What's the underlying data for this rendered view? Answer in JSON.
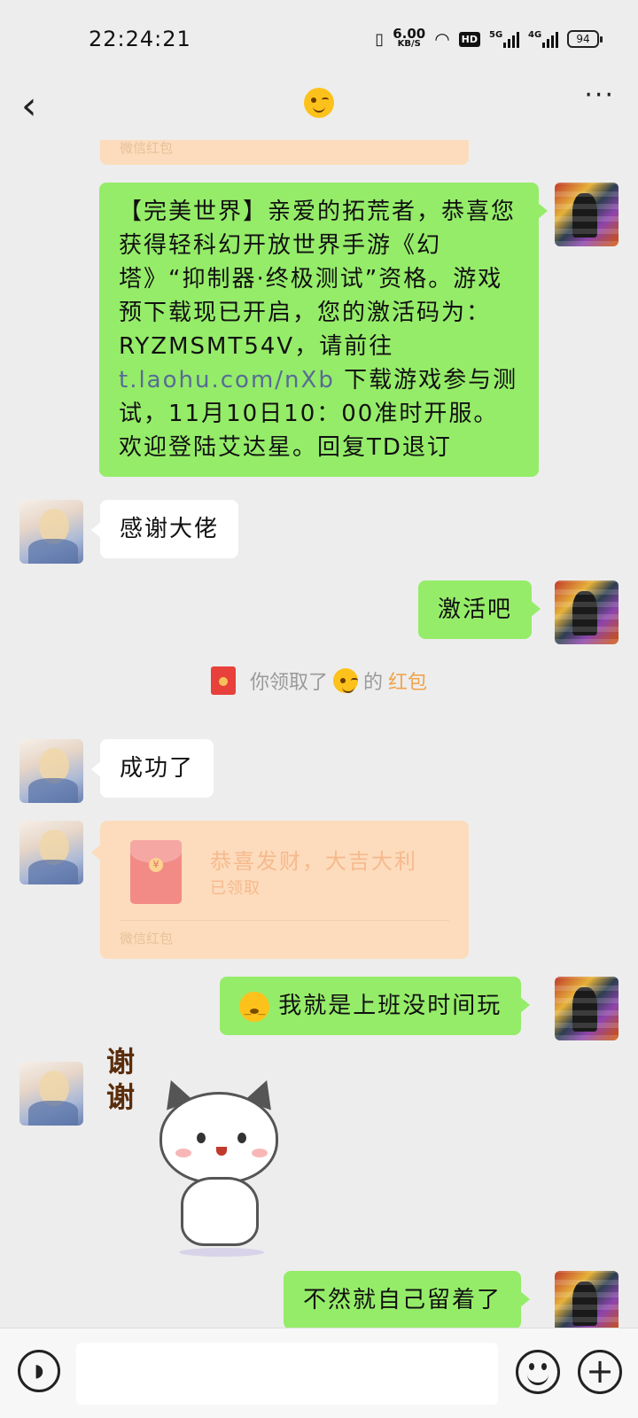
{
  "status_bar": {
    "time": "22:24:21",
    "net_speed_value": "6.00",
    "net_speed_unit": "KB/S",
    "hd_label": "HD",
    "sig1_label": "5G",
    "sig2_label": "4G",
    "battery": "94"
  },
  "header": {
    "title_emoji": "wink-emoji",
    "more": "···",
    "back": "‹"
  },
  "messages": {
    "rp_partial_footer": "微信红包",
    "m1_prefix": "【完美世界】亲爱的拓荒者，恭喜您获得轻科幻开放世界手游《幻塔》“抑制器·终极测试”资格。游戏预下载现已开启，您的激活码为：RYZMSMT54V，请前往 ",
    "m1_link": "t.laohu.com/nXb",
    "m1_suffix": " 下载游戏参与测试，11月10日10：00准时开服。欢迎登陆艾达星。回复TD退订",
    "m2": "感谢大佬",
    "m3": "激活吧",
    "notice_prefix": "你领取了",
    "notice_mid": "的",
    "notice_link": "红包",
    "m4": "成功了",
    "rp_title": "恭喜发财，大吉大利",
    "rp_status": "已领取",
    "rp_footer": "微信红包",
    "m5": "我就是上班没时间玩",
    "sticker_text": "谢谢",
    "m6": "不然就自己留着了"
  },
  "input_bar": {
    "placeholder": "",
    "plus": "+"
  },
  "colors": {
    "self_bubble": "#95ec69",
    "other_bubble": "#ffffff",
    "red_packet": "#fcdcbc",
    "background": "#ededed"
  }
}
